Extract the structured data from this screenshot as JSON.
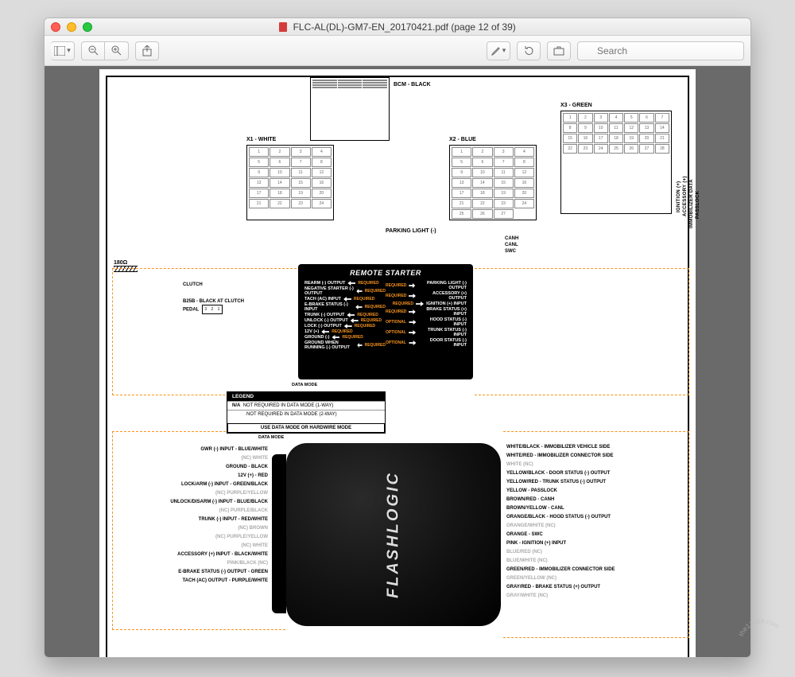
{
  "window": {
    "title": "FLC-AL(DL)-GM7-EN_20170421.pdf (page 12 of 39)"
  },
  "toolbar": {
    "search_placeholder": "Search"
  },
  "connectors": {
    "bcm": "BCM - BLACK",
    "x1": "X1 - WHITE",
    "x2": "X2 - BLUE",
    "x3": "X3 - GREEN"
  },
  "x3_side_labels": [
    "IGNITION (+)",
    "ACCESSORY (+)",
    "IMMOBILIZER DATA",
    "PASSLOCK"
  ],
  "between_x2_x3": {
    "top": "PARKING LIGHT (-)",
    "canh": "CANH",
    "canl": "CANL",
    "swc": "SWC"
  },
  "resistor": "180Ω",
  "clutch": "CLUTCH",
  "b25b": "B25B - BLACK AT CLUTCH PEDAL",
  "remote_starter": {
    "title": "REMOTE STARTER",
    "left": [
      "REARM (-) OUTPUT",
      "NEGATIVE STARTER (-) OUTPUT",
      "TACH (AC) INPUT",
      "E-BRAKE STATUS (-) INPUT",
      "TRUNK (-) OUTPUT",
      "UNLOCK (-) OUTPUT",
      "LOCK (-) OUTPUT",
      "12V (+)",
      "GROUND (-)",
      "GROUND WHEN RUNNING (-) OUTPUT"
    ],
    "right": [
      "PARKING LIGHT (-) OUTPUT",
      "ACCESSORY (+) OUTPUT",
      "IGNITION (+) INPUT",
      "BRAKE STATUS (+) INPUT",
      "HOOD STATUS (-) INPUT",
      "TRUNK STATUS (-) INPUT",
      "DOOR STATUS (-) INPUT"
    ],
    "left_flags": [
      "REQUIRED",
      "REQUIRED",
      "REQUIRED",
      "REQUIRED",
      "REQUIRED",
      "REQUIRED",
      "REQUIRED",
      "REQUIRED",
      "REQUIRED",
      "REQUIRED"
    ],
    "right_flags": [
      "REQUIRED",
      "REQUIRED",
      "REQUIRED",
      "REQUIRED",
      "OPTIONAL",
      "OPTIONAL",
      "OPTIONAL"
    ],
    "data_mode_left": "DATA MODE",
    "data_mode_bottom": "DATA MODE"
  },
  "legend": {
    "header": "LEGEND",
    "na_heading": "N/A",
    "na_line1": "NOT REQUIRED IN DATA MODE (1-WAY)",
    "na_line2": "NOT REQUIRED IN DATA MODE (2-WAY)",
    "use_mode": "USE DATA MODE OR HARDWIRE MODE"
  },
  "flashlogic_logo": "FLASHLOGIC",
  "left_wires": [
    "GWR (-) INPUT - BLUE/WHITE",
    "(NC) WHITE",
    "GROUND - BLACK",
    "12V (+) - RED",
    "LOCK/ARM (-) INPUT - GREEN/BLACK",
    "(NC) PURPLE/YELLOW",
    "UNLOCK/DISARM (-) INPUT - BLUE/BLACK",
    "(NC) PURPLE/BLACK",
    "TRUNK (-) INPUT - RED/WHITE",
    "(NC) BROWN",
    "(NC) PURPLE/YELLOW",
    "(NC) WHITE",
    "ACCESSORY (+) INPUT - BLACK/WHITE",
    "PINK/BLACK (NC)",
    "E-BRAKE STATUS (-) OUTPUT - GREEN",
    "TACH (AC) OUTPUT - PURPLE/WHITE"
  ],
  "right_wires": [
    "WHITE/BLACK - IMMOBILIZER VEHICLE SIDE",
    "WHITE/RED - IMMOBILIZER CONNECTOR SIDE",
    "WHITE (NC)",
    "YELLOW/BLACK - DOOR STATUS (-) OUTPUT",
    "YELLOW/RED - TRUNK STATUS (-) OUTPUT",
    "YELLOW - PASSLOCK",
    "BROWN/RED - CANH",
    "BROWN/YELLOW - CANL",
    "ORANGE/BLACK - HOOD STATUS (-) OUTPUT",
    "ORANGE/WHITE (NC)",
    "ORANGE - SWC",
    "PINK - IGNITION (+) INPUT",
    "BLUE/RED (NC)",
    "BLUE/WHITE (NC)",
    "GREEN/RED - IMMOBILIZER CONNECTOR SIDE",
    "GREEN/YELLOW (NC)",
    "GRAY/RED - BRAKE STATUS (+) OUTPUT",
    "GRAY/WHITE (NC)"
  ],
  "watermark": "the12volt.com"
}
